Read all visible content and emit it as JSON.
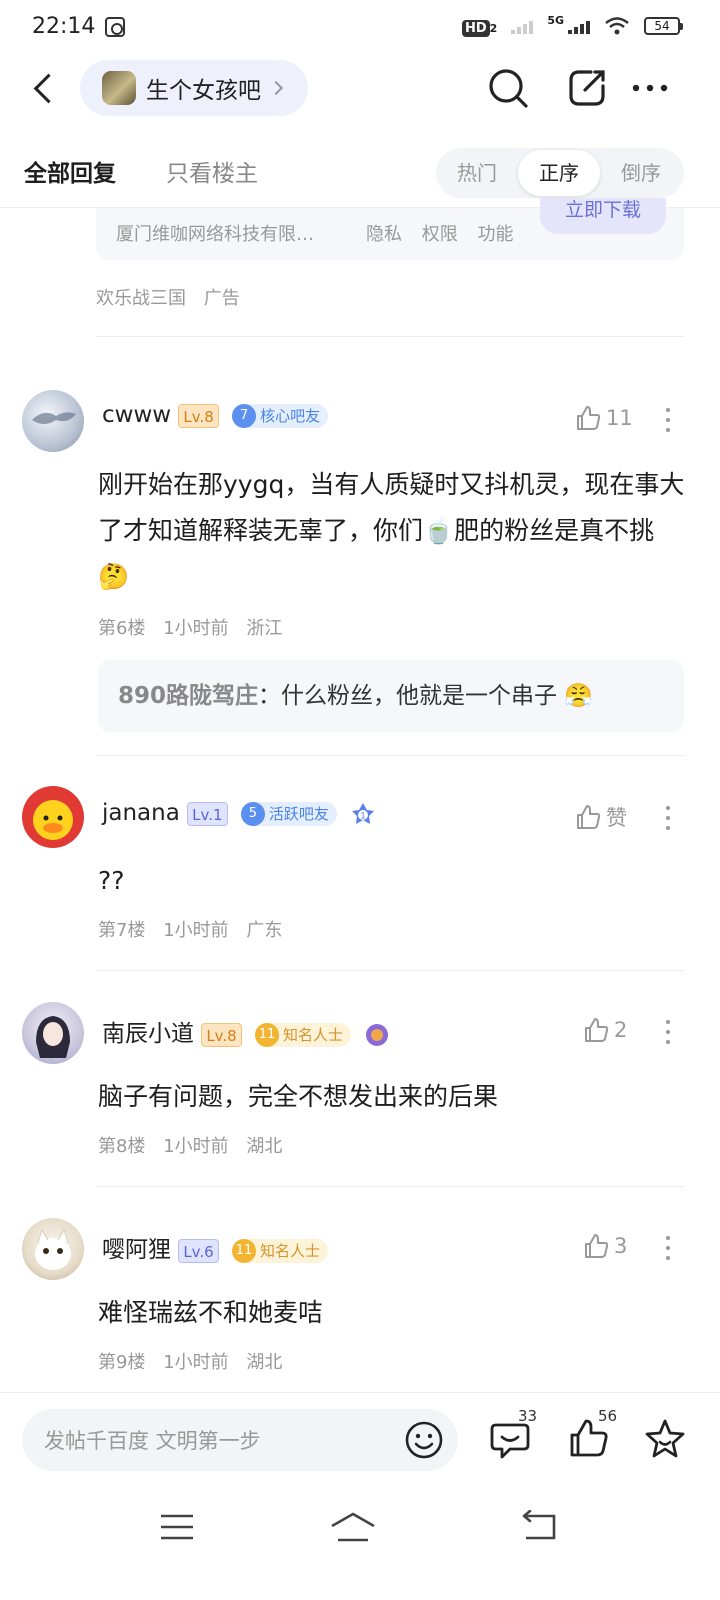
{
  "status_bar": {
    "time": "22:14",
    "hd": "HD",
    "hd_sub": "2",
    "network": "5G",
    "battery": "54"
  },
  "nav": {
    "forum_name": "生个女孩吧"
  },
  "tabs": {
    "all_replies": "全部回复",
    "op_only": "只看楼主"
  },
  "sort": {
    "options": [
      "热门",
      "正序",
      "倒序"
    ],
    "selected": "正序"
  },
  "ad": {
    "company": "厦门维咖网络科技有限…",
    "links": [
      "隐私",
      "权限",
      "功能"
    ],
    "download_label": "立即下载",
    "title": "欢乐战三国",
    "tag": "广告"
  },
  "posts": [
    {
      "username": "cwww",
      "level": "Lv.8",
      "level_color": "orange",
      "badge_num": "7",
      "badge_label": "核心吧友",
      "likes": "11",
      "content": "刚开始在那yygq，当有人质疑时又抖机灵，现在事大了才知道解释装无辜了，你们🍵肥的粉丝是真不挑 🤔",
      "floor": "第6楼",
      "time": "1小时前",
      "location": "浙江",
      "reply": {
        "user": "890路陇驾庄",
        "text": "什么粉丝，他就是一个串子 😤"
      }
    },
    {
      "username": "janana",
      "level": "Lv.1",
      "level_color": "blue",
      "badge_num": "5",
      "badge_label": "活跃吧友",
      "likes": "赞",
      "content": "??",
      "floor": "第7楼",
      "time": "1小时前",
      "location": "广东"
    },
    {
      "username": "南辰小道",
      "level": "Lv.8",
      "level_color": "orange",
      "badge_num": "11",
      "badge_label": "知名人士",
      "likes": "2",
      "content": "脑子有问题，完全不想发出来的后果",
      "floor": "第8楼",
      "time": "1小时前",
      "location": "湖北"
    },
    {
      "username": "嘤阿狸",
      "level": "Lv.6",
      "level_color": "blue",
      "badge_num": "11",
      "badge_label": "知名人士",
      "likes": "3",
      "content": "难怪瑞兹不和她麦咭",
      "floor": "第9楼",
      "time": "1小时前",
      "location": "湖北"
    }
  ],
  "bottom_bar": {
    "compose_placeholder": "发帖千百度 文明第一步",
    "comment_count": "33",
    "like_count": "56"
  },
  "colors": {
    "accent": "#6b6fd8",
    "orange_level": "#d2801a",
    "blue_badge": "#4a84e6",
    "gold_badge": "#d7932a"
  }
}
